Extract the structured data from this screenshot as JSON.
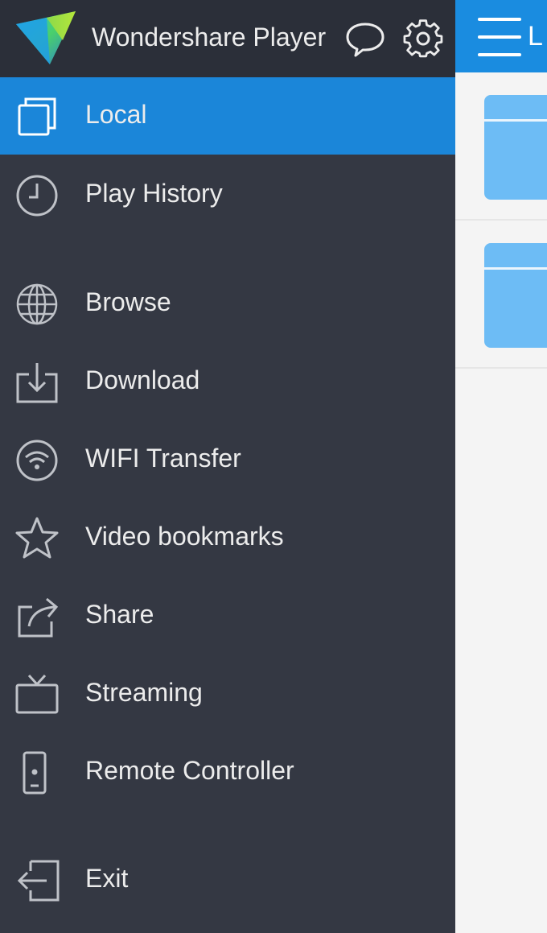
{
  "drawer": {
    "app_name": "Wondershare Player",
    "items": [
      {
        "id": "local",
        "label": "Local",
        "icon": "local-icon",
        "active": true
      },
      {
        "id": "play-history",
        "label": "Play History",
        "icon": "clock-icon",
        "active": false
      },
      {
        "id": "browse",
        "label": "Browse",
        "icon": "globe-icon",
        "active": false
      },
      {
        "id": "download",
        "label": "Download",
        "icon": "download-icon",
        "active": false
      },
      {
        "id": "wifi-transfer",
        "label": "WIFI Transfer",
        "icon": "wifi-icon",
        "active": false
      },
      {
        "id": "video-bookmarks",
        "label": "Video bookmarks",
        "icon": "star-icon",
        "active": false
      },
      {
        "id": "share",
        "label": "Share",
        "icon": "share-icon",
        "active": false
      },
      {
        "id": "streaming",
        "label": "Streaming",
        "icon": "tv-icon",
        "active": false
      },
      {
        "id": "remote-controller",
        "label": "Remote Controller",
        "icon": "remote-icon",
        "active": false
      },
      {
        "id": "exit",
        "label": "Exit",
        "icon": "exit-icon",
        "active": false
      }
    ]
  },
  "main": {
    "title": "L"
  },
  "colors": {
    "drawer_bg": "#343843",
    "header_bg": "#2b2f39",
    "accent": "#1b86d9",
    "folder": "#6dbcf5"
  }
}
